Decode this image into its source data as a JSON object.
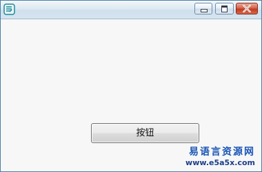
{
  "window": {
    "title": ""
  },
  "titlebar": {
    "app_icon": "app-icon",
    "minimize_icon": "minimize-icon",
    "maximize_icon": "maximize-icon",
    "close_icon": "close-icon",
    "close_color": "#c2391c"
  },
  "content": {
    "button_label": "按钮"
  },
  "watermark": {
    "title": "易语言资源网",
    "url": "www.e5a5x.com",
    "color": "#1a56b6"
  }
}
